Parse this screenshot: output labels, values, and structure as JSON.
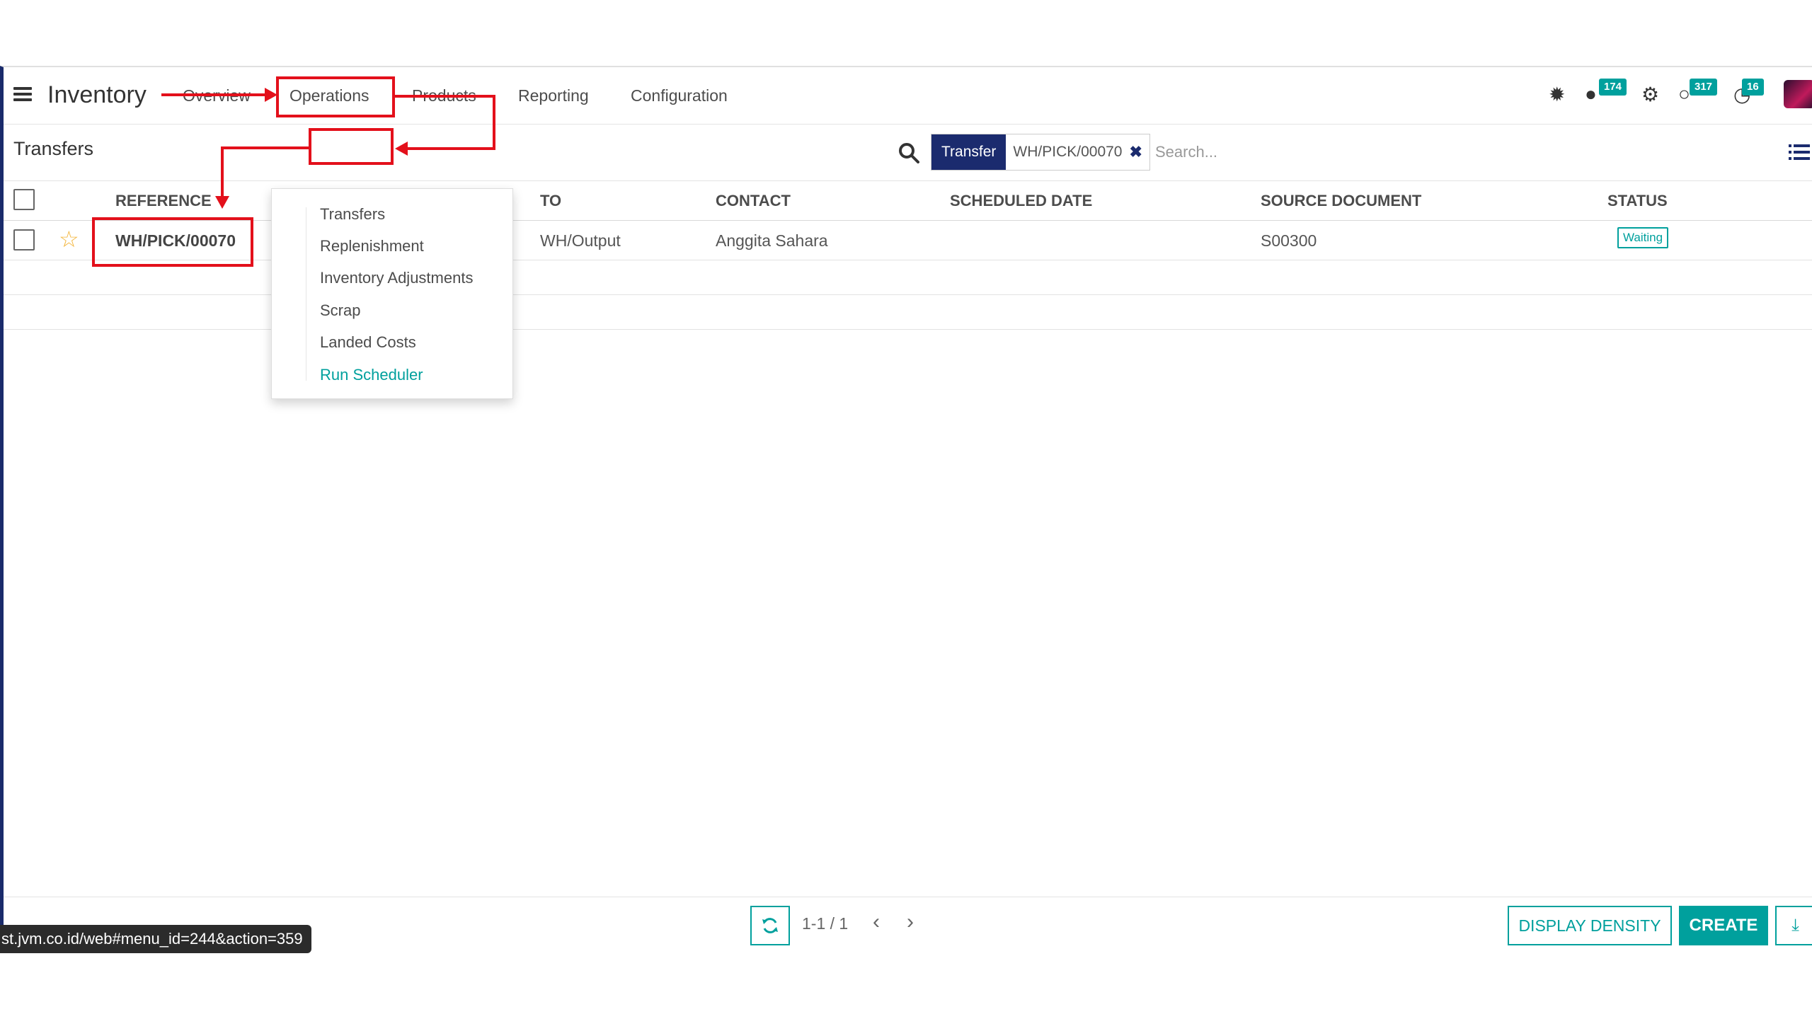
{
  "navbar": {
    "app_title": "Inventory",
    "menu": [
      "Overview",
      "Operations",
      "Products",
      "Reporting",
      "Configuration"
    ],
    "badges": {
      "messages": "174",
      "activities": "317",
      "clock": "16"
    }
  },
  "controlpanel": {
    "breadcrumb": "Transfers",
    "facet_label": "Transfer",
    "facet_value": "WH/PICK/00070",
    "search_placeholder": "Search..."
  },
  "dropdown": {
    "items": [
      "Transfers",
      "Replenishment",
      "Inventory Adjustments",
      "Scrap",
      "Landed Costs",
      "Run Scheduler"
    ]
  },
  "table": {
    "columns": [
      "REFERENCE",
      "TO",
      "CONTACT",
      "SCHEDULED DATE",
      "SOURCE DOCUMENT",
      "STATUS"
    ],
    "rows": [
      {
        "reference": "WH/PICK/00070",
        "to": "WH/Output",
        "contact": "Anggita Sahara",
        "scheduled_date": "",
        "source_document": "S00300",
        "status": "Waiting"
      }
    ]
  },
  "pager": {
    "value": "1-1 / 1"
  },
  "buttons": {
    "display_density": "DISPLAY DENSITY",
    "create": "CREATE"
  },
  "status_url": "st.jvm.co.id/web#menu_id=244&action=359",
  "colors": {
    "accent": "#00a09d",
    "navy": "#1b2b6e",
    "annotation": "#e3101b"
  }
}
